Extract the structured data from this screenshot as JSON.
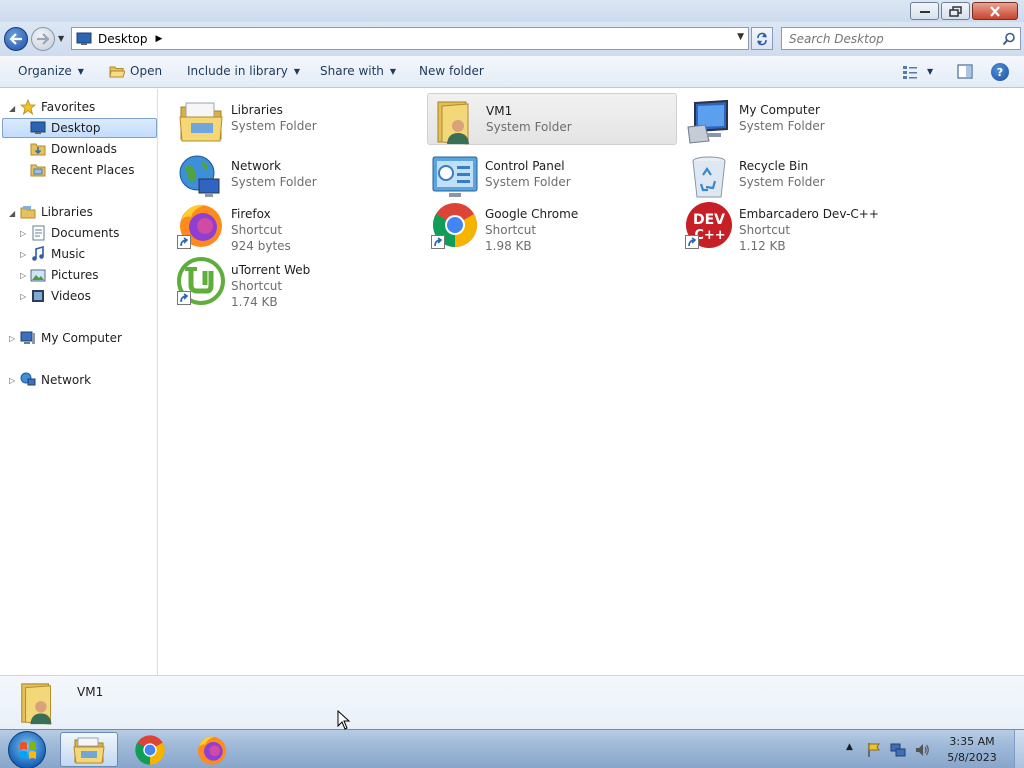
{
  "window": {
    "controls": [
      "minimize",
      "maximize",
      "close"
    ]
  },
  "address": {
    "breadcrumb": "Desktop",
    "search_placeholder": "Search Desktop"
  },
  "commands": {
    "organize": "Organize",
    "open": "Open",
    "include_in_library": "Include in library",
    "share_with": "Share with",
    "new_folder": "New folder"
  },
  "nav": {
    "favorites": "Favorites",
    "desktop": "Desktop",
    "downloads": "Downloads",
    "recent_places": "Recent Places",
    "libraries": "Libraries",
    "documents": "Documents",
    "music": "Music",
    "pictures": "Pictures",
    "videos": "Videos",
    "my_computer": "My Computer",
    "network": "Network"
  },
  "items": [
    {
      "name": "Libraries",
      "type": "System Folder",
      "icon": "libraries-icon"
    },
    {
      "name": "VM1",
      "type": "System Folder",
      "icon": "user-folder-icon",
      "selected": true
    },
    {
      "name": "My Computer",
      "type": "System Folder",
      "icon": "computer-icon"
    },
    {
      "name": "Network",
      "type": "System Folder",
      "icon": "network-icon"
    },
    {
      "name": "Control Panel",
      "type": "System Folder",
      "icon": "control-panel-icon"
    },
    {
      "name": "Recycle Bin",
      "type": "System Folder",
      "icon": "recycle-bin-icon"
    },
    {
      "name": "Firefox",
      "type": "Shortcut",
      "size": "924 bytes",
      "icon": "firefox-icon"
    },
    {
      "name": "Google Chrome",
      "type": "Shortcut",
      "size": "1.98 KB",
      "icon": "chrome-icon"
    },
    {
      "name": "Embarcadero Dev-C++",
      "type": "Shortcut",
      "size": "1.12 KB",
      "icon": "devcpp-icon"
    },
    {
      "name": "uTorrent Web",
      "type": "Shortcut",
      "size": "1.74 KB",
      "icon": "utorrent-icon"
    }
  ],
  "details": {
    "selected_name": "VM1"
  },
  "taskbar": {
    "pinned": [
      "explorer-icon",
      "chrome-icon",
      "firefox-icon"
    ],
    "time": "3:35 AM",
    "date": "5/8/2023"
  },
  "colors": {
    "selection": "#c2dcfd",
    "command_text": "#1e395b",
    "secondary_text": "#6d6d6d"
  }
}
